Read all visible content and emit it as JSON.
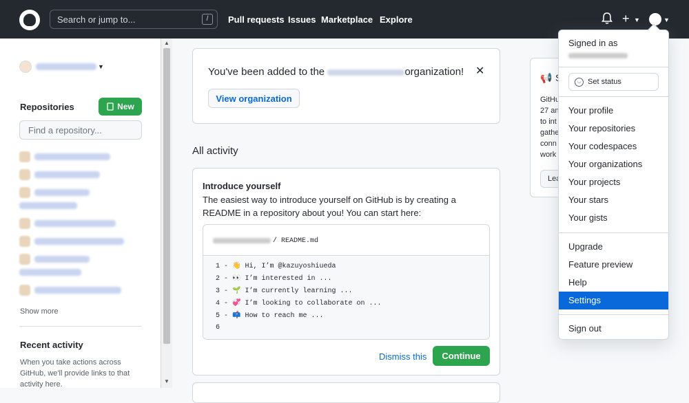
{
  "header": {
    "search_placeholder": "Search or jump to...",
    "search_shortcut": "/",
    "nav": [
      "Pull requests",
      "Issues",
      "Marketplace",
      "Explore"
    ],
    "plus_label": "+"
  },
  "sidebar": {
    "repositories_heading": "Repositories",
    "new_button": "New",
    "find_placeholder": "Find a repository...",
    "show_more": "Show more",
    "recent_heading": "Recent activity",
    "recent_text": "When you take actions across GitHub, we'll provide links to that activity here."
  },
  "notice": {
    "text_before": "You've been added to the",
    "text_after": "organization!",
    "view_button": "View organization",
    "close": "✕"
  },
  "feed": {
    "all_activity": "All activity",
    "intro_title": "Introduce yourself",
    "intro_desc": "The easiest way to introduce yourself on GitHub is by creating a README in a repository about you! You can start here:",
    "readme_file": "/ README.md",
    "code_lines": [
      "1 - 👋 Hi, I’m @kazuyoshiueda",
      "2 - 👀 I’m interested in ...",
      "3 - 🌱 I’m currently learning ...",
      "4 - 💞️ I’m looking to collaborate on ...",
      "5 - 📫 How to reach me ...",
      "6"
    ],
    "dismiss": "Dismiss this",
    "continue": "Continue"
  },
  "side_card": {
    "heading_initial": "S",
    "lines": [
      "GitHu",
      "27 an",
      "to int",
      "gathe",
      "conn",
      "work"
    ],
    "learn": "Lear"
  },
  "dropdown": {
    "signed_in_as": "Signed in as",
    "set_status": "Set status",
    "items_group1": [
      "Your profile",
      "Your repositories",
      "Your codespaces",
      "Your organizations",
      "Your projects",
      "Your stars",
      "Your gists"
    ],
    "items_group2": [
      "Upgrade",
      "Feature preview",
      "Help",
      "Settings"
    ],
    "sign_out": "Sign out",
    "active_item": "Settings"
  },
  "colors": {
    "header_bg": "#24292f",
    "accent_blue": "#0969da",
    "green": "#2da44e"
  }
}
